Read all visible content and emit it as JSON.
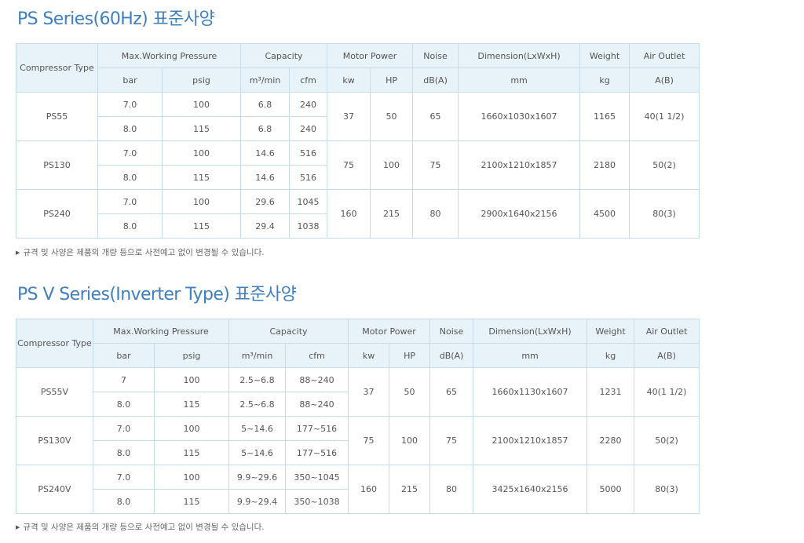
{
  "sections": [
    {
      "title": "PS Series(60Hz) 표준사양",
      "header": {
        "type": "Compressor Type",
        "groups": [
          "Max.Working Pressure",
          "Capacity",
          "Motor Power",
          "Noise",
          "Dimension(LxWxH)",
          "Weight",
          "Air Outlet"
        ],
        "units": [
          "bar",
          "psig",
          "m³/min",
          "cfm",
          "kw",
          "HP",
          "dB(A)",
          "mm",
          "kg",
          "A(B)"
        ]
      },
      "models": [
        {
          "name": "PS55",
          "kw": "37",
          "hp": "50",
          "noise": "65",
          "dimension": "1660x1030x1607",
          "weight": "1165",
          "outlet": "40(1 1/2)",
          "rows": [
            {
              "bar": "7.0",
              "psig": "100",
              "m3min": "6.8",
              "cfm": "240"
            },
            {
              "bar": "8.0",
              "psig": "115",
              "m3min": "6.8",
              "cfm": "240"
            }
          ]
        },
        {
          "name": "PS130",
          "kw": "75",
          "hp": "100",
          "noise": "75",
          "dimension": "2100x1210x1857",
          "weight": "2180",
          "outlet": "50(2)",
          "rows": [
            {
              "bar": "7.0",
              "psig": "100",
              "m3min": "14.6",
              "cfm": "516"
            },
            {
              "bar": "8.0",
              "psig": "115",
              "m3min": "14.6",
              "cfm": "516"
            }
          ]
        },
        {
          "name": "PS240",
          "kw": "160",
          "hp": "215",
          "noise": "80",
          "dimension": "2900x1640x2156",
          "weight": "4500",
          "outlet": "80(3)",
          "rows": [
            {
              "bar": "7.0",
              "psig": "100",
              "m3min": "29.6",
              "cfm": "1045"
            },
            {
              "bar": "8.0",
              "psig": "115",
              "m3min": "29.4",
              "cfm": "1038"
            }
          ]
        }
      ],
      "note": "규격 및 사양은 제품의 개량 등으로 사전예고 없이 변경될 수 있습니다."
    },
    {
      "title": "PS V Series(Inverter Type) 표준사양",
      "header": {
        "type": "Compressor Type",
        "groups": [
          "Max.Working Pressure",
          "Capacity",
          "Motor Power",
          "Noise",
          "Dimension(LxWxH)",
          "Weight",
          "Air Outlet"
        ],
        "units": [
          "bar",
          "psig",
          "m³/min",
          "cfm",
          "kw",
          "HP",
          "dB(A)",
          "mm",
          "kg",
          "A(B)"
        ]
      },
      "models": [
        {
          "name": "PS55V",
          "kw": "37",
          "hp": "50",
          "noise": "65",
          "dimension": "1660x1130x1607",
          "weight": "1231",
          "outlet": "40(1 1/2)",
          "rows": [
            {
              "bar": "7",
              "psig": "100",
              "m3min": "2.5~6.8",
              "cfm": "88~240"
            },
            {
              "bar": "8.0",
              "psig": "115",
              "m3min": "2.5~6.8",
              "cfm": "88~240"
            }
          ]
        },
        {
          "name": "PS130V",
          "kw": "75",
          "hp": "100",
          "noise": "75",
          "dimension": "2100x1210x1857",
          "weight": "2280",
          "outlet": "50(2)",
          "rows": [
            {
              "bar": "7.0",
              "psig": "100",
              "m3min": "5~14.6",
              "cfm": "177~516"
            },
            {
              "bar": "8.0",
              "psig": "115",
              "m3min": "5~14.6",
              "cfm": "177~516"
            }
          ]
        },
        {
          "name": "PS240V",
          "kw": "160",
          "hp": "215",
          "noise": "80",
          "dimension": "3425x1640x2156",
          "weight": "5000",
          "outlet": "80(3)",
          "rows": [
            {
              "bar": "7.0",
              "psig": "100",
              "m3min": "9.9~29.6",
              "cfm": "350~1045"
            },
            {
              "bar": "8.0",
              "psig": "115",
              "m3min": "9.9~29.4",
              "cfm": "350~1038"
            }
          ]
        }
      ],
      "note": "규격 및 사양은 제품의 개량 등으로 사전예고 없이 변경될 수 있습니다."
    }
  ]
}
